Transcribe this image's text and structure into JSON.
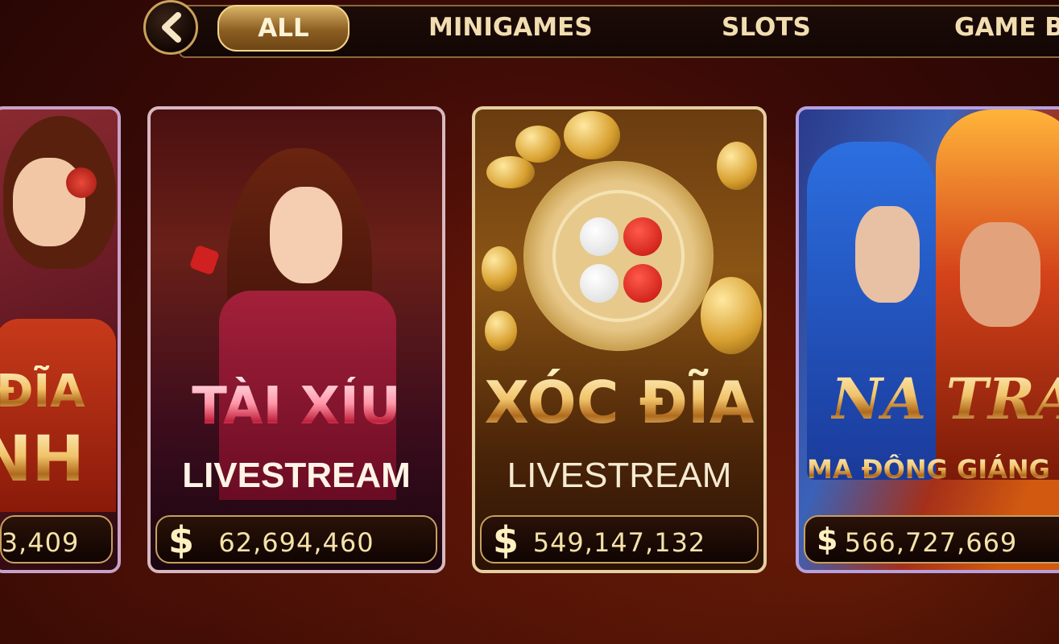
{
  "nav": {
    "back_icon": "chevron-left-icon",
    "tabs": [
      {
        "label": "ALL",
        "active": true
      },
      {
        "label": "MINIGAMES",
        "active": false
      },
      {
        "label": "SLOTS",
        "active": false
      },
      {
        "label": "GAME B",
        "active": false
      }
    ]
  },
  "games": [
    {
      "title_line1": "ĐĨA",
      "title_line2": "INH",
      "jackpot_symbol": "$",
      "jackpot": "3,409"
    },
    {
      "title_line1": "TÀI XỈU",
      "title_line2": "LIVESTREAM",
      "jackpot_symbol": "$",
      "jackpot": "62,694,460"
    },
    {
      "title_line1": "XÓC ĐĨA",
      "title_line2": "LIVESTREAM",
      "jackpot_symbol": "$",
      "jackpot": "549,147,132"
    },
    {
      "title_line1": "NA TRA",
      "title_line2": "MA ĐỒNG GIÁNG TH",
      "jackpot_symbol": "$",
      "jackpot": "566,727,669"
    }
  ],
  "colors": {
    "accent_gold": "#c9a25a",
    "background": "#3a0a06"
  }
}
